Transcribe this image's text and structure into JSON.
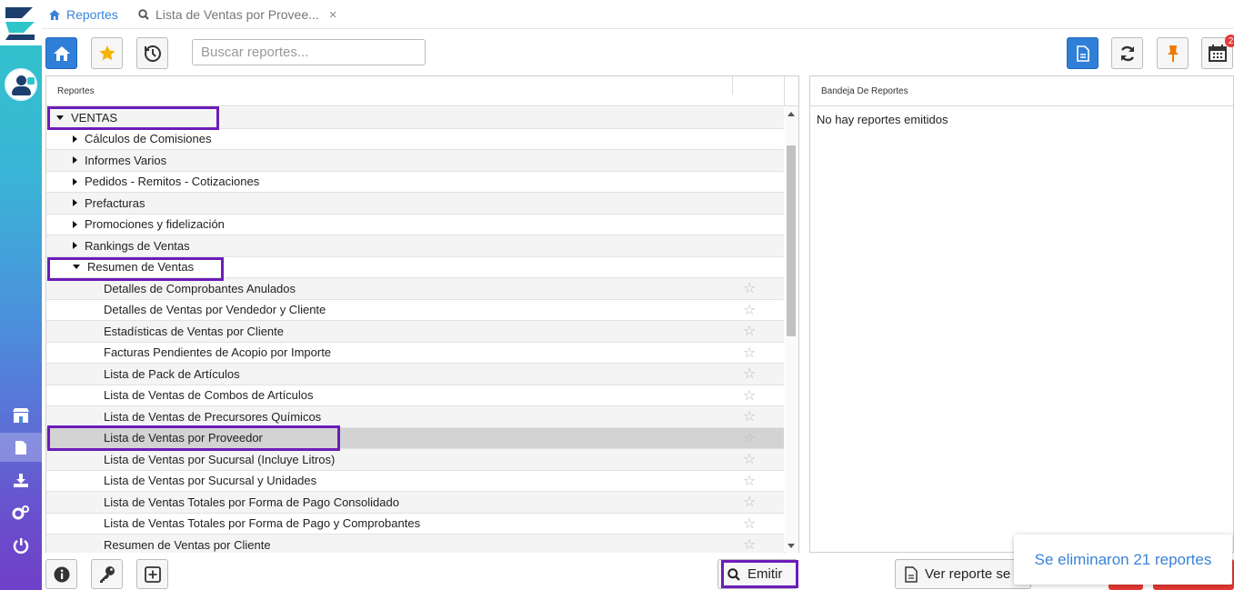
{
  "tabs": [
    {
      "label": "Reportes"
    },
    {
      "label": "Lista de Ventas por Provee..."
    }
  ],
  "search": {
    "placeholder": "Buscar reportes..."
  },
  "calendar_badge": "2",
  "left_panel": {
    "header": "Reportes"
  },
  "right_panel": {
    "header": "Bandeja De Reportes",
    "empty_text": "No hay reportes emitidos"
  },
  "tree": [
    {
      "label": "VENTAS",
      "level": 0,
      "expanded": true
    },
    {
      "label": "Cálculos de Comisiones",
      "level": 1,
      "expanded": false
    },
    {
      "label": "Informes Varios",
      "level": 1,
      "expanded": false
    },
    {
      "label": "Pedidos - Remitos - Cotizaciones",
      "level": 1,
      "expanded": false
    },
    {
      "label": "Prefacturas",
      "level": 1,
      "expanded": false
    },
    {
      "label": "Promociones y fidelización",
      "level": 1,
      "expanded": false
    },
    {
      "label": "Rankings de Ventas",
      "level": 1,
      "expanded": false
    },
    {
      "label": "Resumen de Ventas",
      "level": 1,
      "expanded": true
    },
    {
      "label": "Detalles de Comprobantes Anulados",
      "level": 2
    },
    {
      "label": "Detalles de Ventas por Vendedor y Cliente",
      "level": 2
    },
    {
      "label": "Estadísticas de Ventas por Cliente",
      "level": 2
    },
    {
      "label": "Facturas Pendientes de Acopio por Importe",
      "level": 2
    },
    {
      "label": "Lista de Pack de Artículos",
      "level": 2
    },
    {
      "label": "Lista de Ventas de Combos de Artículos",
      "level": 2
    },
    {
      "label": "Lista de Ventas de Precursores Químicos",
      "level": 2
    },
    {
      "label": "Lista de Ventas por Proveedor",
      "level": 2,
      "selected": true
    },
    {
      "label": "Lista de Ventas por Sucursal (Incluye Litros)",
      "level": 2
    },
    {
      "label": "Lista de Ventas por Sucursal y Unidades",
      "level": 2
    },
    {
      "label": "Lista de Ventas Totales por Forma de Pago Consolidado",
      "level": 2
    },
    {
      "label": "Lista de Ventas Totales por Forma de Pago y Comprobantes",
      "level": 2
    },
    {
      "label": "Resumen de Ventas por Cliente",
      "level": 2
    }
  ],
  "buttons": {
    "emit": "Emitir",
    "view_report": "Ver reporte se"
  },
  "toast": "Se eliminaron 21 reportes",
  "colors": {
    "accent": "#3a83d8",
    "primary_button": "#2f7fd8",
    "highlight": "#6c1cb8",
    "danger": "#e53935"
  }
}
